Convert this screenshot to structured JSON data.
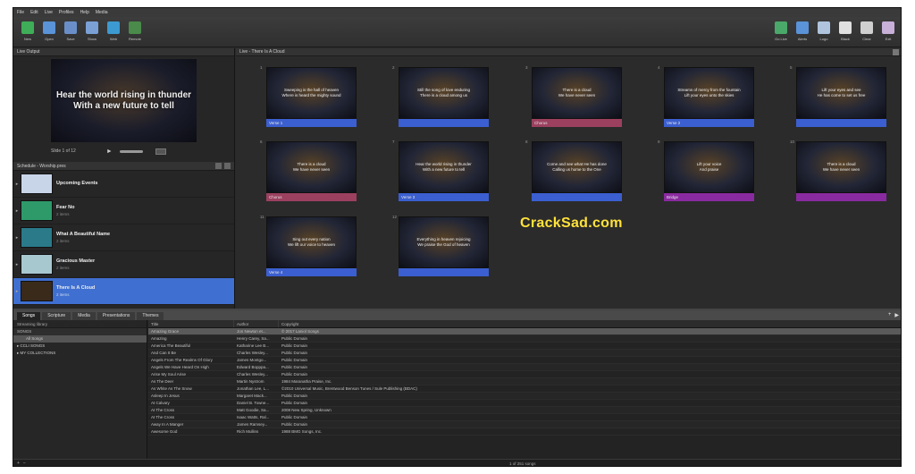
{
  "menu": [
    "File",
    "Edit",
    "Live",
    "Profiles",
    "Help",
    "Media"
  ],
  "toolbar_left": [
    {
      "label": "New",
      "icon": "new-document-icon",
      "color": "#3fae58"
    },
    {
      "label": "Open",
      "icon": "open-folder-icon",
      "color": "#5a93d8"
    },
    {
      "label": "Save",
      "icon": "save-icon",
      "color": "#6a8fc8"
    },
    {
      "label": "Show",
      "icon": "display-icon",
      "color": "#7aa0d6"
    },
    {
      "label": "Web",
      "icon": "globe-icon",
      "color": "#3c9ad0"
    },
    {
      "label": "Remote",
      "icon": "remote-icon",
      "color": "#4a8a4a"
    }
  ],
  "toolbar_right": [
    {
      "label": "Go Live",
      "icon": "go-live-icon",
      "color": "#4aa86a"
    },
    {
      "label": "Alerts",
      "icon": "alerts-icon",
      "color": "#5a93d8"
    },
    {
      "label": "Logo",
      "icon": "logo-icon",
      "color": "#b0c4de"
    },
    {
      "label": "Black",
      "icon": "black-screen-icon",
      "color": "#e0e0e0"
    },
    {
      "label": "Clear",
      "icon": "clear-icon",
      "color": "#d0d0d0"
    },
    {
      "label": "Exit",
      "icon": "exit-icon",
      "color": "#c8b0d8"
    }
  ],
  "live_output": {
    "header": "Live Output",
    "preview_text": "Hear the world rising in thunder\nWith a new future to tell",
    "slide_counter": "Slide 1 of 12"
  },
  "schedule": {
    "header": "Schedule - Worship.pres",
    "items": [
      {
        "title": "Upcoming Events",
        "sub": "",
        "thumb": "#c8d4e8"
      },
      {
        "title": "Fear No",
        "sub": "2 items",
        "thumb": "#2e9a6a"
      },
      {
        "title": "What A Beautiful Name",
        "sub": "2 items",
        "thumb": "#2a7a8a"
      },
      {
        "title": "Gracious Master",
        "sub": "2 items",
        "thumb": "#a8c8d0"
      },
      {
        "title": "There Is A Cloud",
        "sub": "2 items",
        "thumb": "#3a2a1a"
      }
    ]
  },
  "slides_panel": {
    "header": "Live - There Is A Cloud",
    "slides": [
      {
        "num": "1",
        "text": "Sweeping is the hall of heaven\nWhere is heard the mighty sound",
        "label": "Verse 1",
        "color": "#3b5fd0"
      },
      {
        "num": "2",
        "text": "Still the song of love enduring\nThere is a cloud among us",
        "label": "",
        "color": "#3b5fd0"
      },
      {
        "num": "3",
        "text": "There is a cloud\nWe have never seen",
        "label": "Chorus",
        "color": "#9c4060"
      },
      {
        "num": "4",
        "text": "Streams of mercy from the fountain\nLift your eyes unto the skies",
        "label": "Verse 2",
        "color": "#3b5fd0"
      },
      {
        "num": "5",
        "text": "Lift your eyes and see\nHe has come to set us free",
        "label": "",
        "color": "#3b5fd0"
      },
      {
        "num": "6",
        "text": "There is a cloud\nWe have never seen",
        "label": "Chorus",
        "color": "#9c4060"
      },
      {
        "num": "7",
        "text": "Hear the world rising in thunder\nWith a new future to tell",
        "label": "Verse 3",
        "color": "#3b5fd0"
      },
      {
        "num": "8",
        "text": "Come and see what He has done\nCalling us home to the One",
        "label": "",
        "color": "#3b5fd0"
      },
      {
        "num": "9",
        "text": "Lift your voice\nAnd praise",
        "label": "Bridge",
        "color": "#8a2aa0"
      },
      {
        "num": "10",
        "text": "There is a cloud\nWe have never seen",
        "label": "",
        "color": "#8a2aa0"
      },
      {
        "num": "11",
        "text": "Sing out every nation\nWe lift our voice to heaven",
        "label": "Verse 4",
        "color": "#3b5fd0"
      },
      {
        "num": "12",
        "text": "Everything in heaven rejoicing\nWe praise the God of heaven",
        "label": "",
        "color": "#3b5fd0"
      }
    ]
  },
  "watermark": "CrackSad.com",
  "bottom_tabs": [
    "Songs",
    "Scripture",
    "Media",
    "Presentations",
    "Themes"
  ],
  "library": {
    "search": "Streaming library",
    "head": "SONGS",
    "items": [
      "All Songs",
      "CCLI SONGS",
      "MY COLLECTIONS"
    ]
  },
  "songs": {
    "columns": [
      "Title",
      "Author",
      "Copyright"
    ],
    "rows": [
      [
        "Amazing Grace",
        "Jon Newton et...",
        "© 2017 Laniol Songs"
      ],
      [
        "Amazing",
        "Henry Carey, Sa...",
        "Public Domain"
      ],
      [
        "America The Beautiful",
        "Katharine Lee B...",
        "Public Domain"
      ],
      [
        "And Can It Be",
        "Charles Wesley...",
        "Public Domain"
      ],
      [
        "Angels From The Realms Of Glory",
        "James Montgo...",
        "Public Domain"
      ],
      [
        "Angels We Have Heard On High",
        "Edward Bopppa...",
        "Public Domain"
      ],
      [
        "Arise My Soul Arise",
        "Charles Wesley...",
        "Public Domain"
      ],
      [
        "As The Deer",
        "Martin Nystrom",
        "1984 Maranatha Praise, Inc."
      ],
      [
        "As White As The Snow",
        "Jonathan Lee, L...",
        "©2010 Universal Music, Brentwood Benson Tunes / Sule Publishing (BDAC)"
      ],
      [
        "Asleep In Jesus",
        "Margaret Mack...",
        "Public Domain"
      ],
      [
        "At Calvary",
        "Daniel B. Towne...",
        "Public Domain"
      ],
      [
        "At The Cross",
        "Matt Goodie, Sa...",
        "2008 New Spring, Unknown"
      ],
      [
        "At The Cross",
        "Isaac Watts, Ral...",
        "Public Domain"
      ],
      [
        "Away In A Manger",
        "James Ramsey...",
        "Public Domain"
      ],
      [
        "Awesome God",
        "Rich Mullins",
        "1988 BMG Songs, Inc."
      ]
    ]
  },
  "status": {
    "count": "1 of 251 songs"
  }
}
